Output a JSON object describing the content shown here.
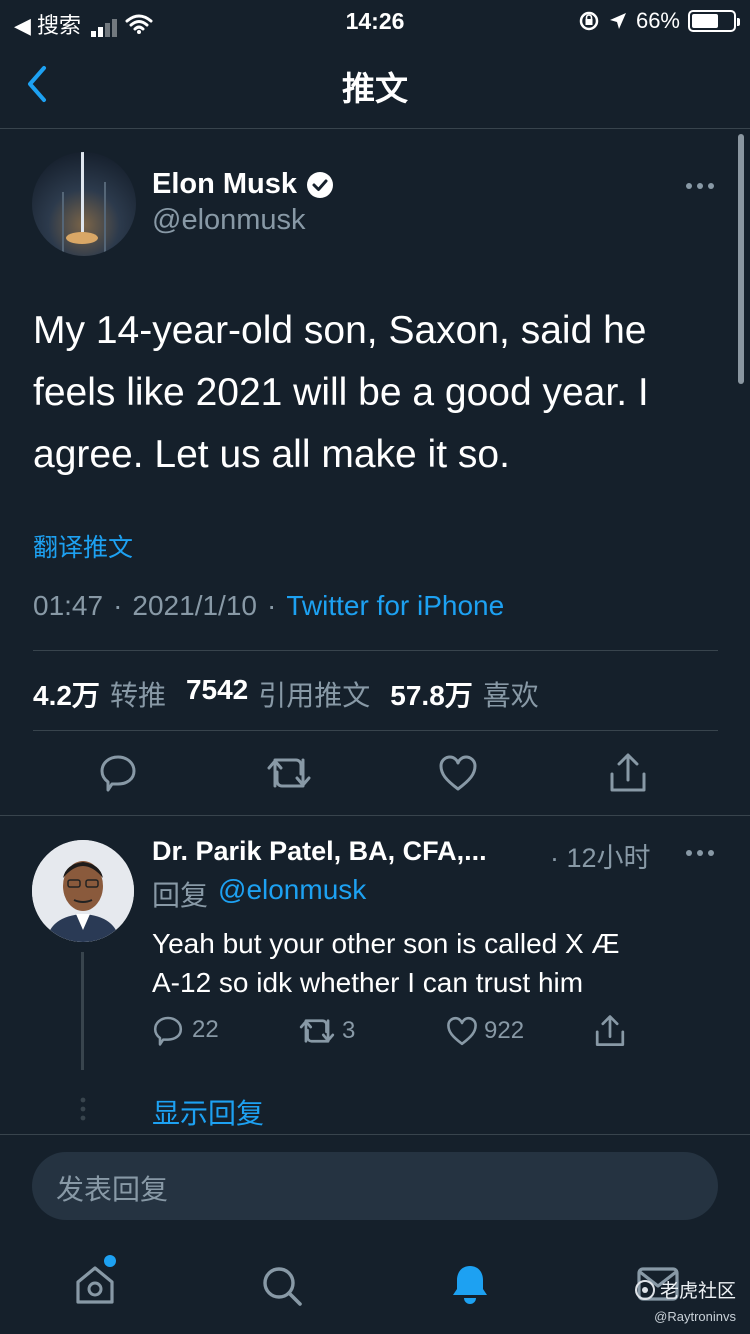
{
  "status_bar": {
    "back_app": "◀ 搜索",
    "time": "14:26",
    "battery": "66%",
    "battery_level": 0.66
  },
  "header": {
    "title": "推文",
    "back_icon": "chevron-left-icon"
  },
  "tweet": {
    "author_name": "Elon Musk",
    "handle": "@elonmusk",
    "text": "My 14-year-old son, Saxon, said he feels like 2021 will be a good year. I agree. Let us all make it so.",
    "translate": "翻译推文",
    "time": "01:47",
    "dot": "·",
    "date": "2021/1/10",
    "source": "Twitter for iPhone",
    "retweets_n": "4.2万",
    "retweets_label": "转推",
    "quotes_n": "7542",
    "quotes_label": "引用推文",
    "likes_n": "57.8万",
    "likes_label": "喜欢"
  },
  "reply": {
    "author_name": "Dr. Parik Patel, BA, CFA,...",
    "time": "· 12小时",
    "reply_to_label": "回复",
    "reply_to_handle": "@elonmusk",
    "text_line1": "Yeah but your other son is called X Æ",
    "text_line2": "A-12 so idk whether I can trust him",
    "replies": "22",
    "retweets": "3",
    "likes": "922",
    "show_replies": "显示回复"
  },
  "composer": {
    "placeholder": "发表回复"
  },
  "watermark": {
    "brand": "老虎社区",
    "handle": "@Raytroninvs"
  },
  "colors": {
    "background": "#15202b",
    "accent": "#1da1f2",
    "muted": "#8899a6",
    "divider": "#38444d"
  }
}
